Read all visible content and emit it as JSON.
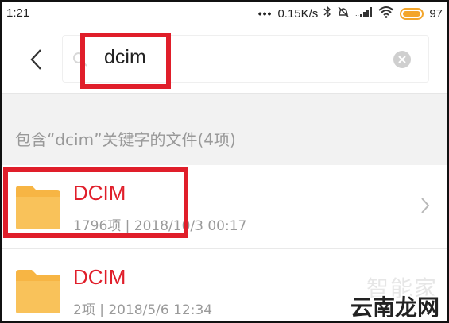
{
  "status_bar": {
    "time": "1:21",
    "dots": "•••",
    "network_speed": "0.15K/s",
    "battery_level": "97",
    "battery_color": "#f3a52a"
  },
  "search": {
    "query": "dcim"
  },
  "section": {
    "label": "包含“dcim”关键字的文件(4项)"
  },
  "results": [
    {
      "name": "DCIM",
      "meta": "1796项 | 2018/10/3 00:17"
    },
    {
      "name": "DCIM",
      "meta": "2项 | 2018/5/6 12:34"
    }
  ],
  "watermark": {
    "faint_text": "智能家",
    "main_text": "云南龙网"
  },
  "colors": {
    "highlight": "#e01e2a",
    "folder": "#f7b544",
    "result_name": "#e01e2a"
  }
}
